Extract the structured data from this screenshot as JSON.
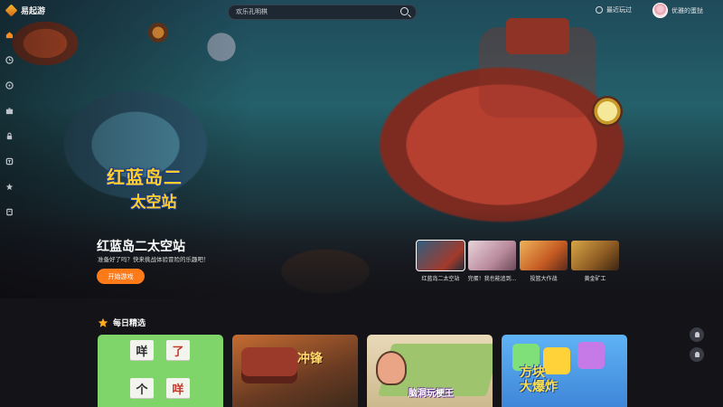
{
  "app": {
    "logo_text": "易起游"
  },
  "search": {
    "placeholder": "欢乐孔明棋"
  },
  "header": {
    "recent_label": "最近玩过",
    "username": "优雅的蛋挞"
  },
  "sidebar": {
    "items": [
      "home-icon",
      "clock-icon",
      "gamepad-icon",
      "puzzle-icon",
      "lock-icon",
      "shirt-icon",
      "star-icon",
      "bookmark-icon"
    ]
  },
  "hero": {
    "logo_line1": "红蓝岛二",
    "logo_line2": "太空站",
    "title": "红蓝岛二太空站",
    "description": "准备好了吗？快来挑战体验冒险的乐趣吧！",
    "start_label": "开始游戏",
    "thumbnails": [
      {
        "label": "红蓝岛二太空站",
        "color": "#3d6b8c",
        "active": true
      },
      {
        "label": "完蛋！我也能追到...",
        "color": "#c9a7b5",
        "active": false
      },
      {
        "label": "投篮大作战",
        "color": "#c97a3a",
        "active": false
      },
      {
        "label": "黄金矿工",
        "color": "#8a5a2a",
        "active": false
      }
    ]
  },
  "daily": {
    "title": "每日精选",
    "cards": [
      {
        "tiles": [
          "咩",
          "了",
          "个",
          "咩"
        ]
      },
      {
        "title": "冲锋"
      },
      {
        "title": "脑洞玩梗王"
      },
      {
        "title_line1": "方块",
        "title_line2": "大爆炸"
      }
    ]
  },
  "colors": {
    "accent": "#ff7a18",
    "background": "#141418"
  }
}
